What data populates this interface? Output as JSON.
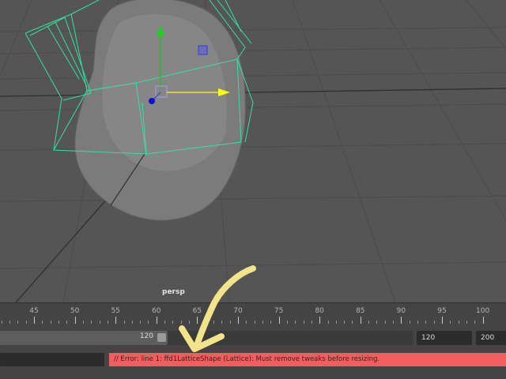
{
  "viewport": {
    "camera_label": "persp",
    "background_color": "#555555",
    "selection_color": "#35e0a0",
    "object": "lattice-deformed-mesh"
  },
  "timeline": {
    "tick_labels": [
      "45",
      "50",
      "55",
      "60",
      "65",
      "70",
      "75",
      "80",
      "85",
      "90",
      "95",
      "100"
    ]
  },
  "range_slider": {
    "range_end_label": "120",
    "playback_end": "120",
    "animation_end": "200"
  },
  "command_line": {
    "input_value": "",
    "result_message": "// Error: line 1: ffd1LatticeShape (Lattice): Must remove tweaks before resizing.",
    "error_color": "#f35d5d"
  },
  "annotation": {
    "arrow_color": "#f2e48a"
  },
  "icons": [
    "move-x-arrow-icon",
    "move-y-arrow-icon",
    "move-center-handle-icon",
    "lattice-point-icon"
  ]
}
